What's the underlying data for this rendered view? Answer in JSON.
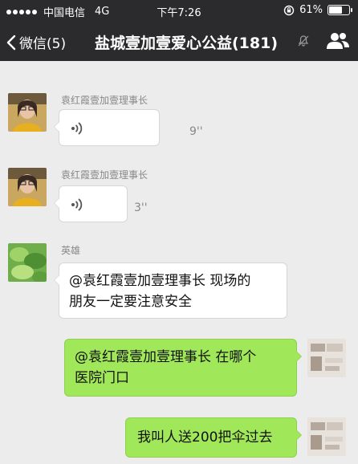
{
  "status_bar": {
    "carrier": "中国电信",
    "network": "4G",
    "time": "下午7:26",
    "battery": "61%"
  },
  "nav": {
    "back_label": "微信(5)",
    "title": "盐城壹加壹爱心公益(181)"
  },
  "messages": [
    {
      "sender": "袁红霞壹加壹理事长",
      "type": "voice",
      "duration": "9''"
    },
    {
      "sender": "袁红霞壹加壹理事长",
      "type": "voice",
      "duration": "3''"
    },
    {
      "sender": "英雄",
      "type": "text",
      "lines": [
        "@袁红霞壹加壹理事长 现场的",
        "朋友一定要注意安全"
      ]
    },
    {
      "sender": "",
      "type": "text",
      "outgoing": true,
      "lines": [
        "@袁红霞壹加壹理事长 在哪个",
        "医院门口"
      ]
    },
    {
      "sender": "",
      "type": "text",
      "outgoing": true,
      "lines": [
        "我叫人送200把伞过去"
      ]
    }
  ],
  "colors": {
    "bar": "#2b2b2e",
    "chat_bg": "#ececec",
    "outgoing_bubble": "#a0e75a",
    "incoming_bubble": "#ffffff"
  },
  "icons": [
    "signal-dots-icon",
    "battery-icon",
    "lock-rotation-icon",
    "back-chevron-icon",
    "mute-icon",
    "group-members-icon",
    "voice-wave-icon"
  ]
}
